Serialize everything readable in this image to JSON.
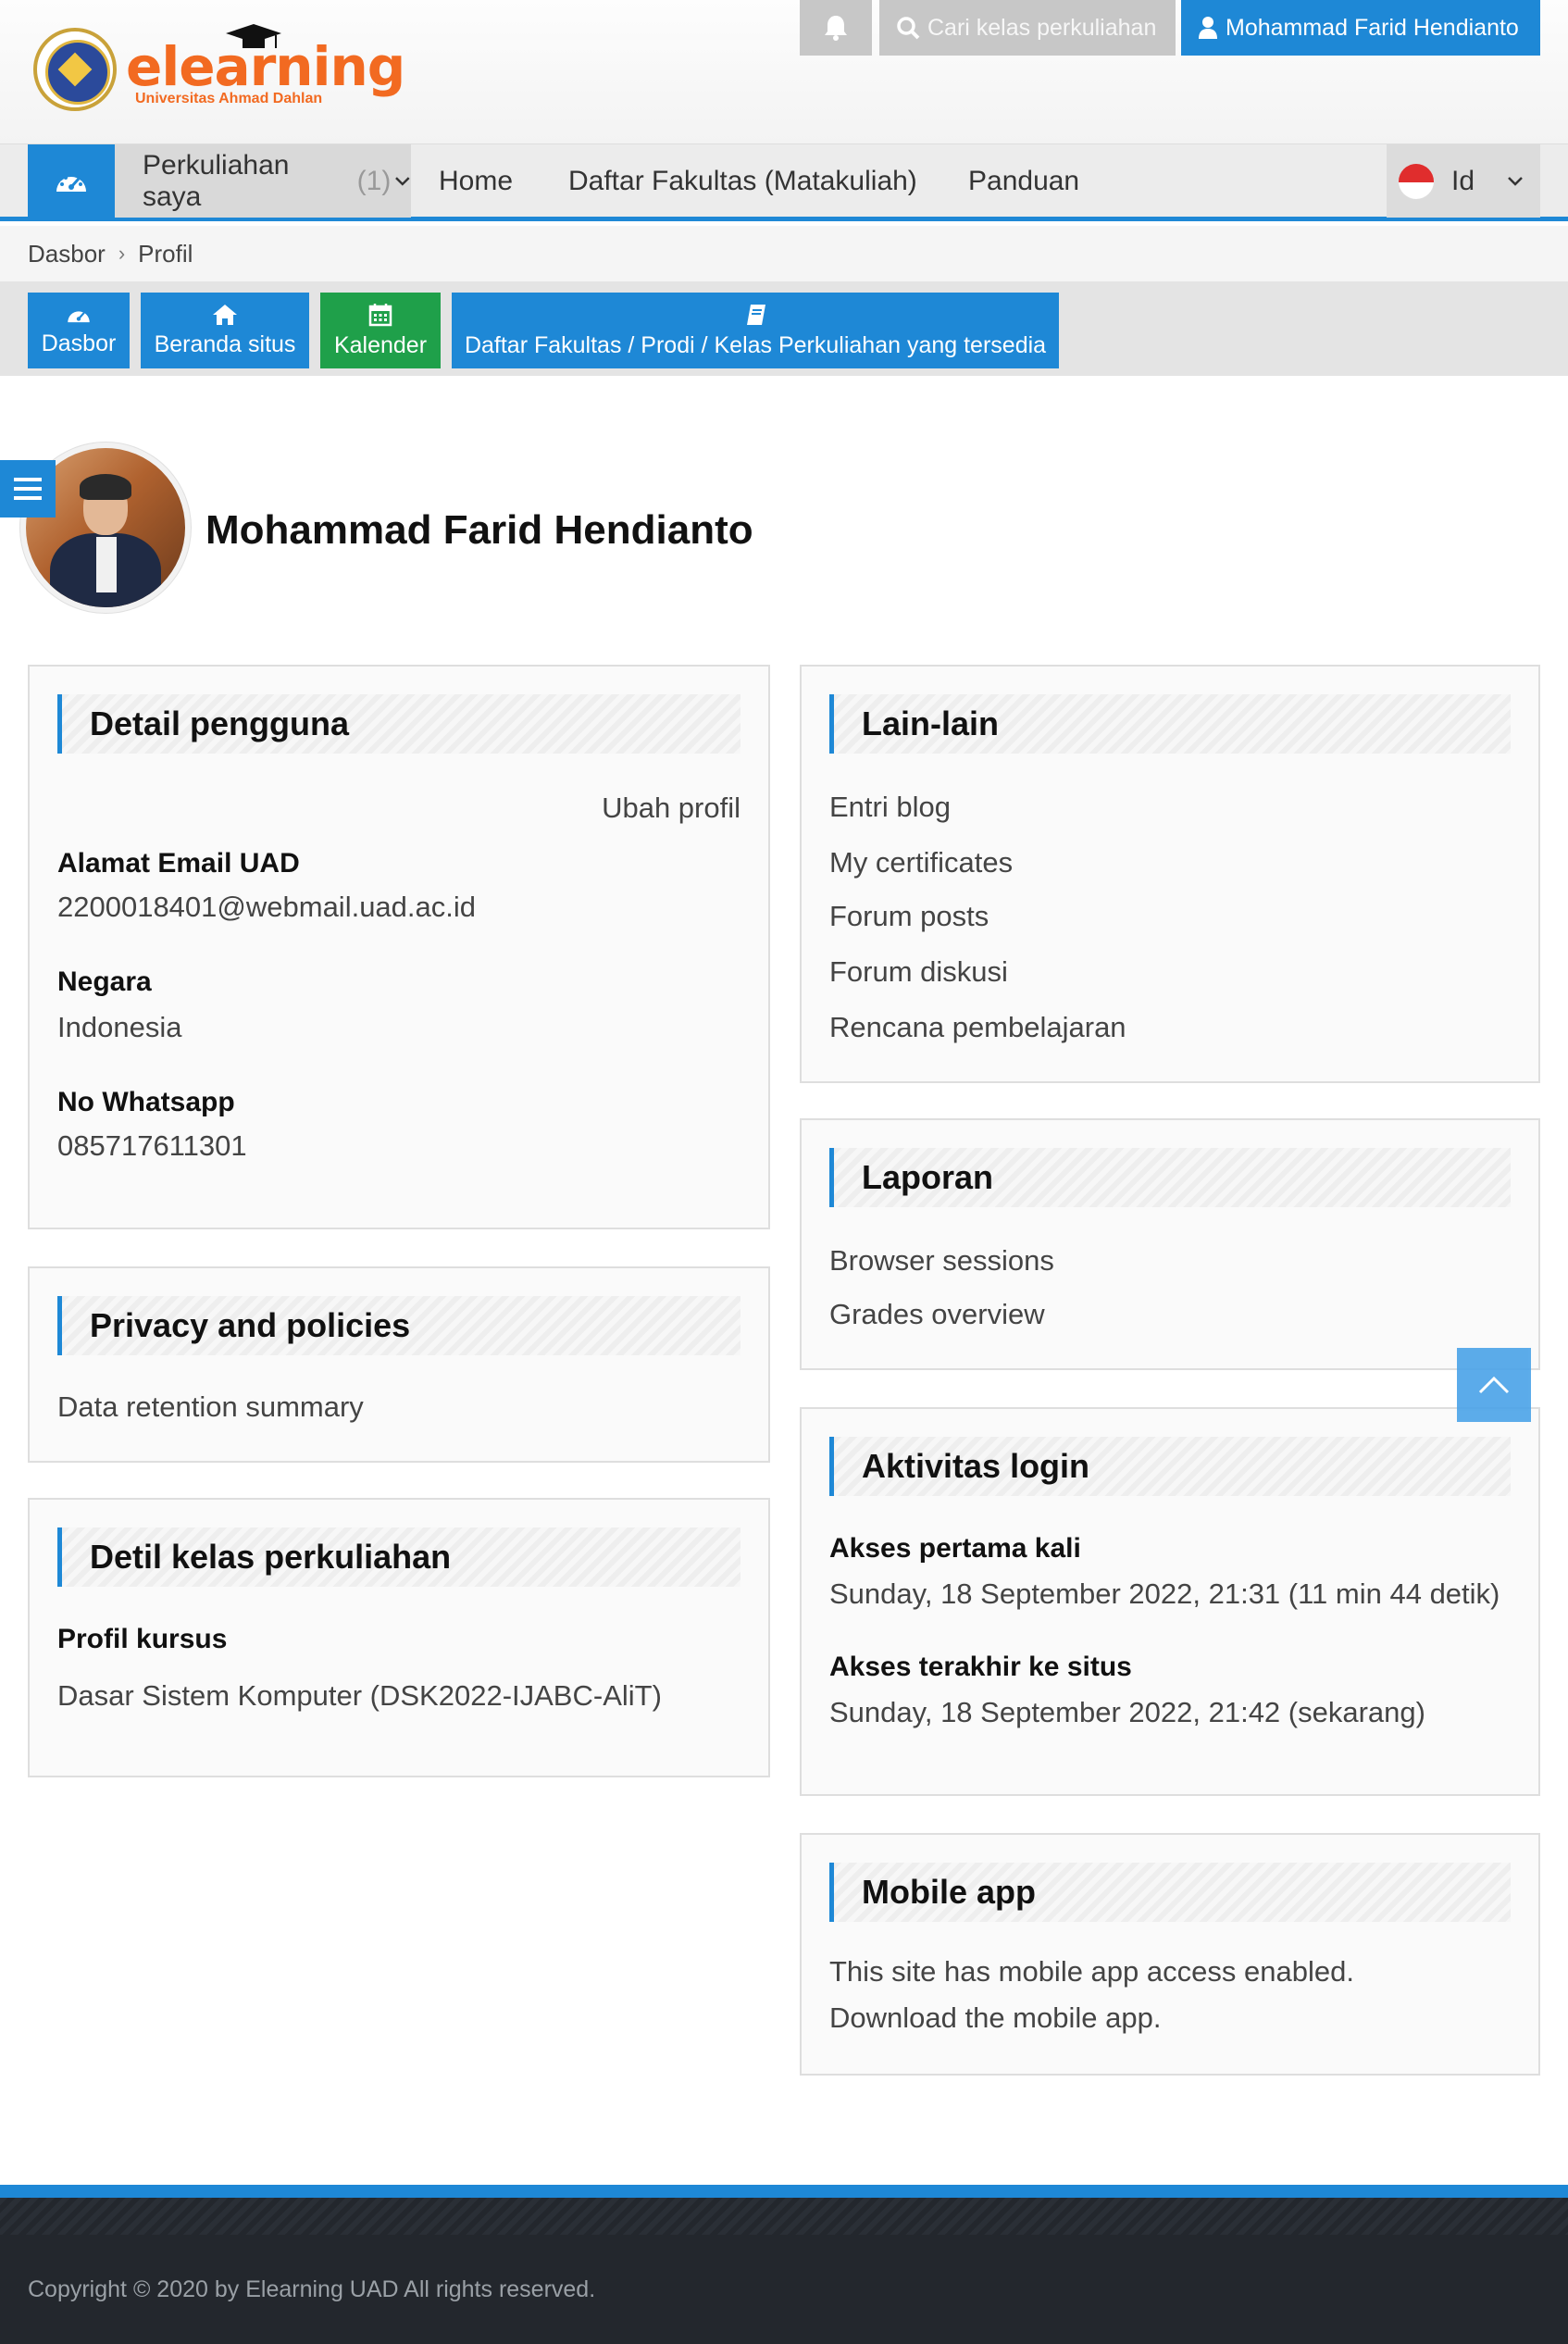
{
  "header": {
    "logo_word": "elearning",
    "logo_sub": "Universitas Ahmad Dahlan",
    "search_placeholder": "Cari kelas perkuliahan",
    "user_name": "Mohammad Farid Hendianto"
  },
  "nav": {
    "my_courses": "Perkuliahan saya",
    "my_courses_count": "(1)",
    "home": "Home",
    "faculties": "Daftar Fakultas (Matakuliah)",
    "guide": "Panduan",
    "lang": "Id"
  },
  "breadcrumb": {
    "items": [
      "Dasbor",
      "Profil"
    ],
    "separator": "›"
  },
  "quick_links": {
    "dashboard": "Dasbor",
    "site_home": "Beranda situs",
    "calendar": "Kalender",
    "faculties": "Daftar Fakultas / Prodi / Kelas Perkuliahan yang tersedia"
  },
  "profile": {
    "name": "Mohammad Farid Hendianto"
  },
  "user_details": {
    "title": "Detail pengguna",
    "edit": "Ubah profil",
    "email_label": "Alamat Email UAD",
    "email_value": "2200018401@webmail.uad.ac.id",
    "country_label": "Negara",
    "country_value": "Indonesia",
    "whatsapp_label": "No Whatsapp",
    "whatsapp_value": "085717611301"
  },
  "privacy": {
    "title": "Privacy and policies",
    "link": "Data retention summary"
  },
  "course_details": {
    "title": "Detil kelas perkuliahan",
    "label": "Profil kursus",
    "course": "Dasar Sistem Komputer (DSK2022-IJABC-AliT)"
  },
  "misc": {
    "title": "Lain-lain",
    "links": [
      "Entri blog",
      "My certificates",
      "Forum posts",
      "Forum diskusi",
      "Rencana pembelajaran"
    ]
  },
  "reports": {
    "title": "Laporan",
    "links": [
      "Browser sessions",
      "Grades overview"
    ]
  },
  "login_activity": {
    "title": "Aktivitas login",
    "first_label": "Akses pertama kali",
    "first_value": "Sunday, 18 September 2022, 21:31  (11 min 44 detik)",
    "last_label": "Akses terakhir ke situs",
    "last_value": "Sunday, 18 September 2022, 21:42  (sekarang)"
  },
  "mobile_app": {
    "title": "Mobile app",
    "line1": "This site has mobile app access enabled.",
    "line2": "Download the mobile app."
  },
  "footer": {
    "copyright": "Copyright © 2020 by Elearning UAD All rights reserved."
  },
  "colors": {
    "primary": "#1e88d6",
    "calendar": "#1fa04a",
    "logo": "#f26a21",
    "footer": "#23272d"
  },
  "icons": [
    "bell-icon",
    "search-icon",
    "user-icon",
    "dashboard-icon",
    "chevron-down-icon",
    "home-icon",
    "calendar-icon",
    "book-icon",
    "menu-icon",
    "chevron-up-icon"
  ]
}
